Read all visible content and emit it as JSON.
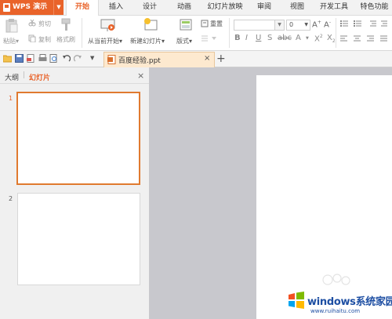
{
  "app": {
    "title": "WPS 演示"
  },
  "tabs": [
    "开始",
    "插入",
    "设计",
    "动画",
    "幻灯片放映",
    "审阅",
    "视图",
    "开发工具",
    "特色功能"
  ],
  "ribbon": {
    "paste_label": "粘贴",
    "cut_label": "剪切",
    "copy_label": "复制",
    "format_painter_label": "格式刷",
    "from_current_label": "从当前开始",
    "new_slide_label": "新建幻灯片",
    "layout_label": "版式",
    "reset_label": "重置",
    "font_size": "0"
  },
  "document_tab": {
    "filename": "百度经验.ppt"
  },
  "side_panel": {
    "outline_tab": "大纲",
    "slides_tab": "幻灯片",
    "slides": [
      {
        "number": "1"
      },
      {
        "number": "2"
      }
    ]
  },
  "watermark": {
    "brand": "windows系统家园",
    "url": "www.ruihaitu.com"
  },
  "colors": {
    "accent": "#e9632a",
    "selected_border": "#e07a2f"
  }
}
